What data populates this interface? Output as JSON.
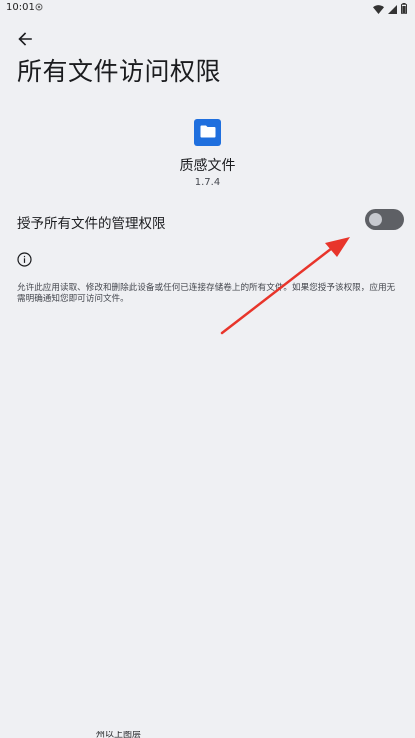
{
  "status_bar": {
    "time": "10:01",
    "notification_icon": "shield-dot-icon",
    "icons": [
      "wifi-icon",
      "signal-icon",
      "battery-icon"
    ]
  },
  "toolbar": {
    "back_icon": "arrow-back-icon"
  },
  "page": {
    "title": "所有文件访问权限"
  },
  "app": {
    "icon": "folder-icon",
    "icon_color": "#1f6fde",
    "name": "质感文件",
    "version": "1.7.4"
  },
  "permission": {
    "label": "授予所有文件的管理权限",
    "toggle_state": "off"
  },
  "info": {
    "icon": "info-icon",
    "description": "允许此应用读取、修改和删除此设备或任何已连接存储卷上的所有文件。如果您授予该权限，应用无需明确通知您即可访问文件。"
  },
  "annotation": {
    "arrow_color": "#e8352b"
  },
  "bottom": {
    "partial_text": "州以上图层"
  }
}
